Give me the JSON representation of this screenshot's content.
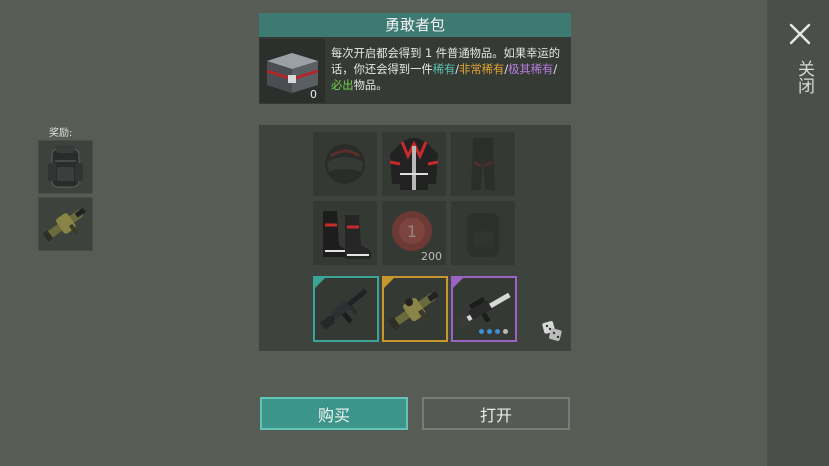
{
  "header": {
    "title": "勇敢者包"
  },
  "chest": {
    "count": "0",
    "icon": "chest-icon"
  },
  "description": {
    "part1": "每次开启都会得到 1 件普通物品。如果幸运的话，你还会得到一件",
    "rare": "稀有",
    "sep1": "/",
    "very_rare": "非常稀有",
    "sep2": "/",
    "extremely_rare": "极其稀有",
    "sep3": "/",
    "guaranteed": "必出",
    "part2": "物品。"
  },
  "rewards": {
    "label": "奖励:",
    "items": [
      "backpack-icon",
      "grenade-launcher-icon"
    ]
  },
  "grid": {
    "helmet_icon": "helmet-icon",
    "jacket_icon": "jacket-icon",
    "pants_icon": "pants-icon",
    "boots_icon": "boots-icon",
    "cap_icon": "bottle-cap-icon",
    "cap_count": "200",
    "backpack_icon": "backpack-icon",
    "rifle_icon": "assault-rifle-icon",
    "launcher_icon": "grenade-launcher-icon",
    "sniper_icon": "sniper-rifle-icon"
  },
  "colors": {
    "teal": "#3aa596",
    "gold": "#c5972c",
    "purple": "#9a63c4"
  },
  "buttons": {
    "buy": "购买",
    "open": "打开"
  },
  "close": {
    "label": "关闭"
  }
}
